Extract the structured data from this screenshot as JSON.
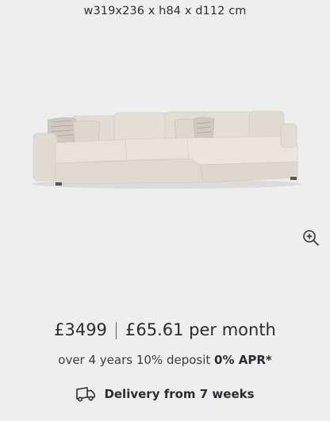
{
  "product": {
    "dimensions": "w319x236 x h84 x d112 cm"
  },
  "image": {
    "subject": "corner sofa",
    "color": "#e6e2da"
  },
  "icons": {
    "zoom": "zoom-in-icon",
    "delivery": "delivery-truck-icon"
  },
  "pricing": {
    "price": "£3499",
    "separator": "|",
    "monthly": "£65.61 per month",
    "finance_prefix": "over 4 years 10% deposit",
    "apr": "0% APR*"
  },
  "delivery": {
    "label": "Delivery from 7 weeks"
  }
}
